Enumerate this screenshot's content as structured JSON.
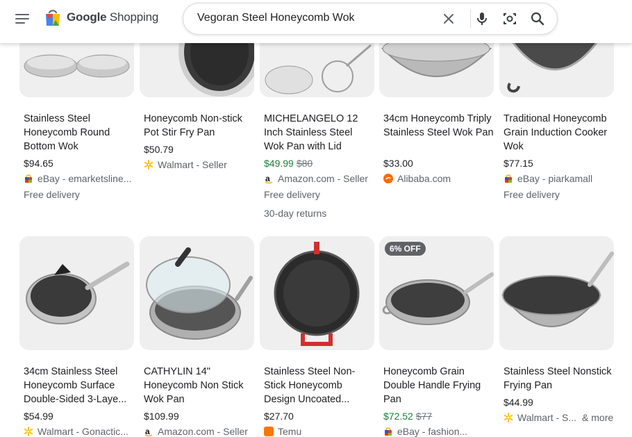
{
  "header": {
    "logo_text_bold": "Google",
    "logo_text": "Shopping",
    "search_value": "Vegoran Steel Honeycomb Wok"
  },
  "colors": {
    "sale_price": "#188038",
    "link_gray": "#5f6368",
    "thumb_bg": "#efefef"
  },
  "products": [
    {
      "title": "Stainless Steel Honeycomb Round Bottom Wok",
      "price": "$94.65",
      "seller_icon": "ebay-icon",
      "seller": "eBay - emarketsline...",
      "extras": [
        "Free delivery"
      ]
    },
    {
      "title": "Honeycomb Non-stick Pot Stir Fry Pan",
      "price": "$50.79",
      "seller_icon": "walmart-icon",
      "seller": "Walmart - Seller",
      "extras": []
    },
    {
      "title": "MICHELANGELO 12 Inch Stainless Steel Wok Pan with Lid",
      "sale_price": "$49.99",
      "old_price": "$80",
      "seller_icon": "amazon-icon",
      "seller": "Amazon.com - Seller",
      "extras": [
        "Free delivery",
        "30-day returns"
      ]
    },
    {
      "title": "34cm Honeycomb Triply Stainless Steel Wok Pan",
      "price": "$33.00",
      "seller_icon": "alibaba-icon",
      "seller": "Alibaba.com",
      "extras": []
    },
    {
      "title": "Traditional Honeycomb Grain Induction Cooker Wok",
      "price": "$77.15",
      "seller_icon": "ebay-icon",
      "seller": "eBay - piarkamall",
      "extras": [
        "Free delivery"
      ]
    },
    {
      "title": "34cm Stainless Steel Honeycomb Surface Double-Sided 3-Laye...",
      "price": "$54.99",
      "seller_icon": "walmart-icon",
      "seller": "Walmart - Gonactic...",
      "extras": []
    },
    {
      "title": "CATHYLIN 14\" Honeycomb Non Stick Wok Pan",
      "price": "$109.99",
      "seller_icon": "amazon-icon",
      "seller": "Amazon.com - Seller",
      "extras": []
    },
    {
      "title": "Stainless Steel Non-Stick Honeycomb Design Uncoated...",
      "price": "$27.70",
      "seller_icon": "temu-icon",
      "seller": "Temu",
      "extras": []
    },
    {
      "title": "Honeycomb Grain Double Handle Frying Pan",
      "badge": "6% OFF",
      "sale_price": "$72.52",
      "old_price": "$77",
      "seller_icon": "ebay-icon",
      "seller": "eBay - fashion...",
      "extras": []
    },
    {
      "title": "Stainless Steel Nonstick Frying Pan",
      "price": "$44.99",
      "seller_icon": "walmart-icon",
      "seller": "Walmart - S...",
      "seller_more": "& more",
      "extras": []
    }
  ]
}
